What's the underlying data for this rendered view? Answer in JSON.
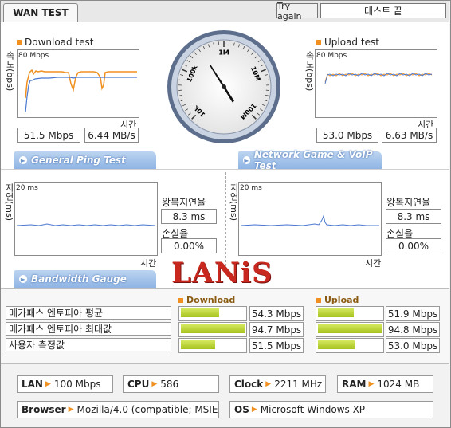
{
  "header": {
    "tab_label": "WAN TEST",
    "try_again": "Try again",
    "status": "테스트 끝"
  },
  "download": {
    "title": "Download test",
    "ylabel": "속도(bps)",
    "scale": "80 Mbps",
    "xlabel": "시간",
    "mbps": "51.5 Mbps",
    "mbs": "6.44 MB/s"
  },
  "upload": {
    "title": "Upload test",
    "ylabel": "속도(bps)",
    "scale": "80 Mbps",
    "xlabel": "시간",
    "mbps": "53.0 Mbps",
    "mbs": "6.63 MB/s"
  },
  "gauge": {
    "labels": [
      "10k",
      "100k",
      "1M",
      "10M",
      "100M"
    ],
    "value_fraction": 0.38
  },
  "tabs": {
    "ping": "General Ping Test",
    "game": "Network Game & VoIP Test",
    "bandwidth": "Bandwidth Gauge"
  },
  "ping_left": {
    "ylabel": "지연(ms)",
    "scale": "20 ms",
    "xlabel": "시간",
    "rtt_label": "왕복지연율",
    "rtt": "8.3 ms",
    "loss_label": "손실율",
    "loss": "0.00%"
  },
  "ping_right": {
    "ylabel": "지연(ms)",
    "scale": "20 ms",
    "xlabel": "시간",
    "rtt_label": "왕복지연율",
    "rtt": "8.3 ms",
    "loss_label": "손실율",
    "loss": "0.00%"
  },
  "logo": "LANiS",
  "compare": {
    "download_head": "Download",
    "upload_head": "Upload",
    "rows": [
      {
        "label": "메가패스 엔토피아 평균",
        "down": "54.3 Mbps",
        "down_frac": 0.34,
        "up": "51.9 Mbps",
        "up_frac": 0.32
      },
      {
        "label": "메가패스 엔토피아 최대값",
        "down": "94.7 Mbps",
        "down_frac": 0.58,
        "up": "94.8 Mbps",
        "up_frac": 0.58
      },
      {
        "label": "사용자 측정값",
        "down": "51.5 Mbps",
        "down_frac": 0.31,
        "up": "53.0 Mbps",
        "up_frac": 0.33
      }
    ]
  },
  "system": {
    "lan_label": "LAN",
    "lan": "100 Mbps",
    "cpu_label": "CPU",
    "cpu": "586",
    "clock_label": "Clock",
    "clock": "2211 MHz",
    "ram_label": "RAM",
    "ram": "1024 MB",
    "browser_label": "Browser",
    "browser": "Mozilla/4.0 (compatible; MSIE 6.0",
    "os_label": "OS",
    "os": "Microsoft Windows XP"
  },
  "colors": {
    "accent_orange": "#f09020",
    "tab_blue": "#8fb4e4",
    "bar_green": "#a6c21c",
    "logo_red": "#c8281e"
  }
}
